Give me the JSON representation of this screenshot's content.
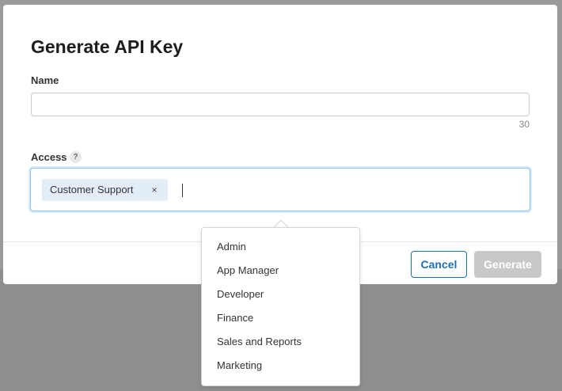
{
  "dialog": {
    "title": "Generate API Key",
    "name_label": "Name",
    "name_value": "",
    "name_placeholder": "",
    "char_counter": "30",
    "access_label": "Access",
    "help_symbol": "?",
    "selected_tokens": [
      {
        "label": "Customer Support",
        "remove_symbol": "×"
      }
    ],
    "cancel_label": "Cancel",
    "generate_label": "Generate"
  },
  "dropdown": {
    "options": [
      {
        "label": "Admin"
      },
      {
        "label": "App Manager"
      },
      {
        "label": "Developer"
      },
      {
        "label": "Finance"
      },
      {
        "label": "Sales and Reports"
      },
      {
        "label": "Marketing"
      }
    ]
  },
  "colors": {
    "accent": "#1f6fb5",
    "focus_border": "#8ec2ec",
    "token_bg": "#e3edf8",
    "disabled_button": "#c8c8c8",
    "overlay": "#8f8f8f"
  },
  "icons": {
    "help": "question-circle-icon",
    "token_remove": "close-icon"
  }
}
